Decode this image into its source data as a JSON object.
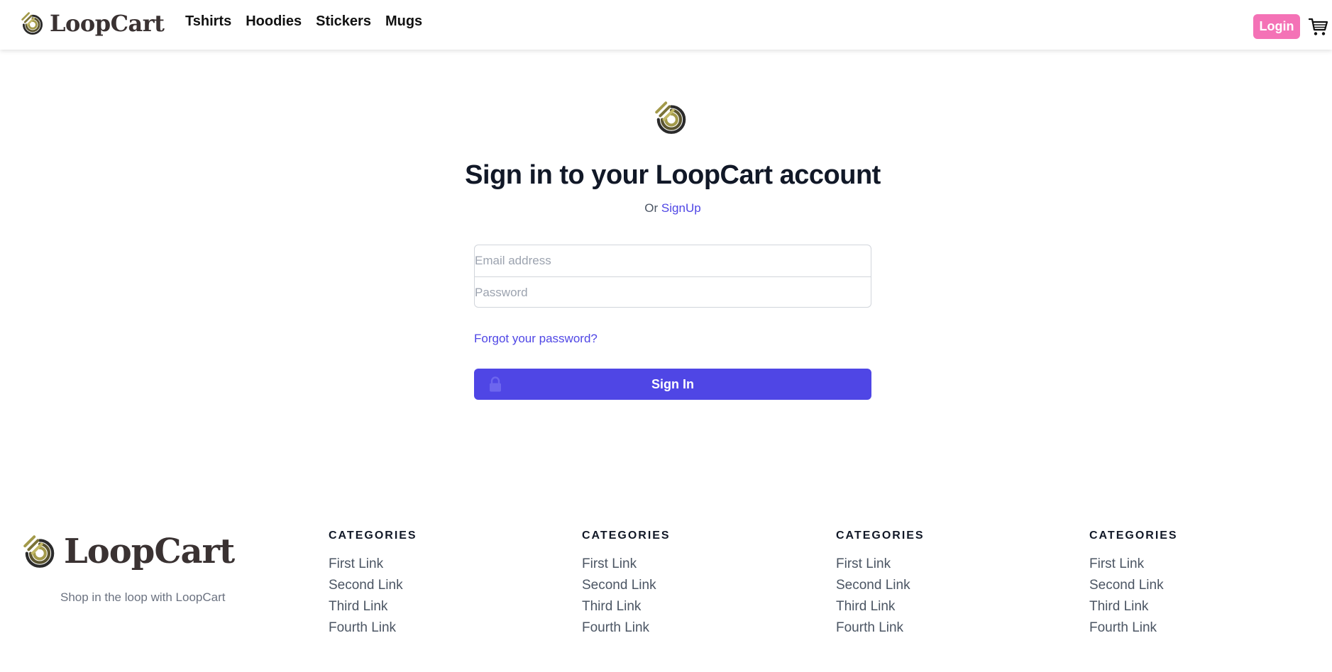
{
  "header": {
    "brand": "LoopCart",
    "nav": [
      "Tshirts",
      "Hoodies",
      "Stickers",
      "Mugs"
    ],
    "login_label": "Login",
    "cart_icon": "cart-icon"
  },
  "signin": {
    "title": "Sign in to your LoopCart account",
    "or_text": "Or",
    "signup_link": "SignUp",
    "email_placeholder": "Email address",
    "password_placeholder": "Password",
    "forgot_link": "Forgot your password?",
    "submit_label": "Sign In",
    "lock_icon": "lock-icon"
  },
  "footer": {
    "brand": "LoopCart",
    "tagline": "Shop in the loop with LoopCart",
    "columns": [
      {
        "heading": "CATEGORIES",
        "links": [
          "First Link",
          "Second Link",
          "Third Link",
          "Fourth Link"
        ]
      },
      {
        "heading": "CATEGORIES",
        "links": [
          "First Link",
          "Second Link",
          "Third Link",
          "Fourth Link"
        ]
      },
      {
        "heading": "CATEGORIES",
        "links": [
          "First Link",
          "Second Link",
          "Third Link",
          "Fourth Link"
        ]
      },
      {
        "heading": "CATEGORIES",
        "links": [
          "First Link",
          "Second Link",
          "Third Link",
          "Fourth Link"
        ]
      }
    ]
  },
  "colors": {
    "accent": "#4f46e5",
    "login_button": "#f472b6",
    "logo_gold": "#a39a4a",
    "logo_dark": "#2b2b2b"
  }
}
